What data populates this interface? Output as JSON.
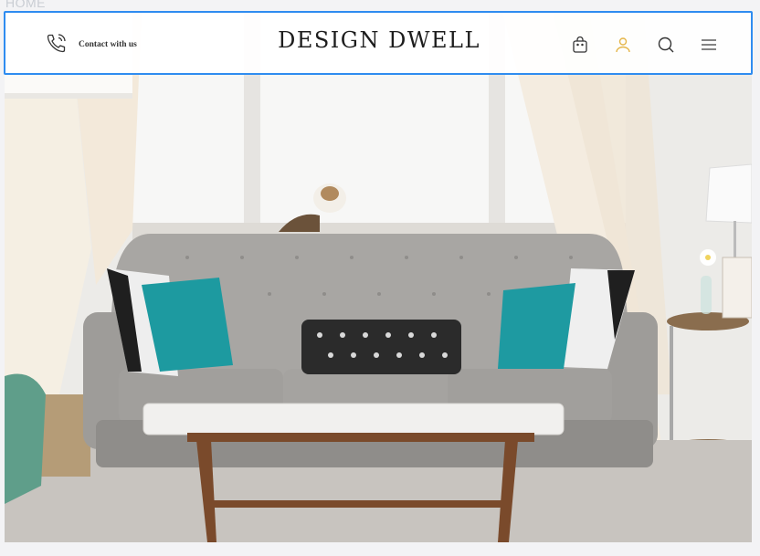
{
  "breadcrumb": "HOME",
  "header": {
    "contact_label": "Contact with us",
    "logo_text": "DESIGN DWELL",
    "accent_color": "#e5b64a",
    "border_color": "#2f8cf0",
    "icons": [
      "shopping-bag-icon",
      "user-icon",
      "search-icon",
      "menu-icon"
    ]
  },
  "hero": {
    "image_alt": "Living room with grey tufted sofa, teal and black-white pillows, marble coffee table, cat on window sill"
  }
}
